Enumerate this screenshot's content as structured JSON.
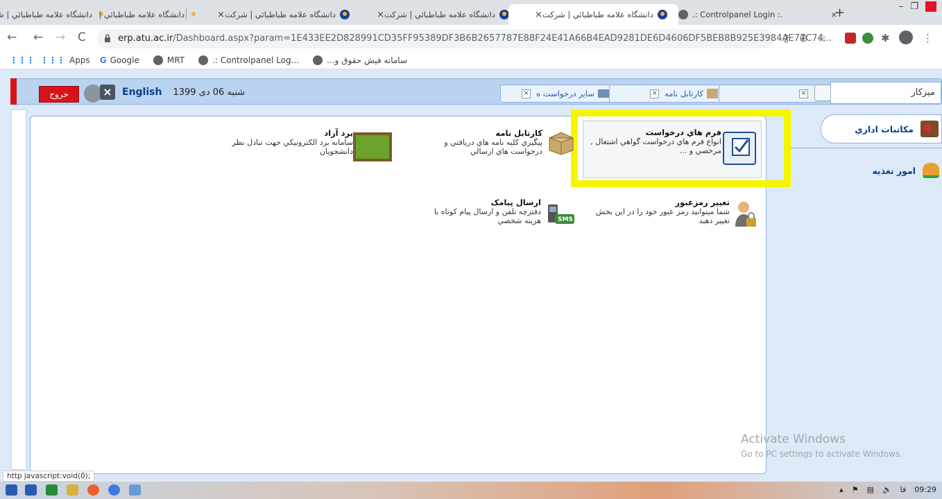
{
  "browser": {
    "tabs": [
      {
        "title": "دانشگاه علامه طباطبائي | شرکت",
        "active": false
      },
      {
        "title": "دانشگاه علامه طباطبائي | شرکت",
        "active": false
      },
      {
        "title": "دانشگاه علامه طباطبائي | شرکت",
        "active": false
      },
      {
        "title": "دانشگاه علامه طباطبائي | شرکت",
        "active": true
      },
      {
        "title": ".: Controlpanel Login :.",
        "active": false
      }
    ],
    "new_tab": "+",
    "url_host": "erp.atu.ac.ir",
    "url_path": "/Dashboard.aspx?param=1E433EE2D828991CD35FF95389DF3B6B2657787E88F24E41A66B4EAD9281DE6D4606DF5BEB8B925E3984AE77C74...",
    "bookmarks": [
      "Apps",
      "Google",
      "MRT",
      ".: Controlpanel Log...",
      "سامانه فیش حقوق و..."
    ]
  },
  "topbar": {
    "exit_label": "خروج",
    "english_label": "English",
    "date_text": "شنبه 06 دی 1399",
    "tabs": [
      "سایر درخواست ه",
      "کارتابل نامه"
    ],
    "search_placeholder": "میزکار"
  },
  "content": {
    "items": [
      {
        "title": "فرم هاي درخواست",
        "desc": "انواع فرم هاي درخواست گواهي اشتغال , مرخصي و ..."
      },
      {
        "title": "کارتابل نامه",
        "desc": "پيگيري کليه نامه هاي دريافتي و درخواست هاي ارسالي"
      },
      {
        "title": "برد آزاد",
        "desc": "سامانه برد الکترونيکي جهت تبادل نظر دانشجويان"
      },
      {
        "title": "تغيير رمزعبور",
        "desc": "شما ميتوانيد رمز عبور خود را در اين بخش تغيير دهيد"
      },
      {
        "title": "ارسال پيامک",
        "desc": "دفترچه تلفن و ارسال پيام کوتاه با هزينه شخصي"
      }
    ],
    "sms_badge": "SMS"
  },
  "sidebar": {
    "items": [
      "مکاتبات اداري",
      "امور تغذيه"
    ]
  },
  "watermark": {
    "line1": "Activate Windows",
    "line2": "Go to PC settings to activate Windows."
  },
  "statusbar": "http javascript:void(0);",
  "taskbar": {
    "time": "09:29",
    "lang": "فا"
  },
  "colors": {
    "accent": "#0c3e8a",
    "highlight": "#f5f500",
    "exit": "#d7131a"
  }
}
